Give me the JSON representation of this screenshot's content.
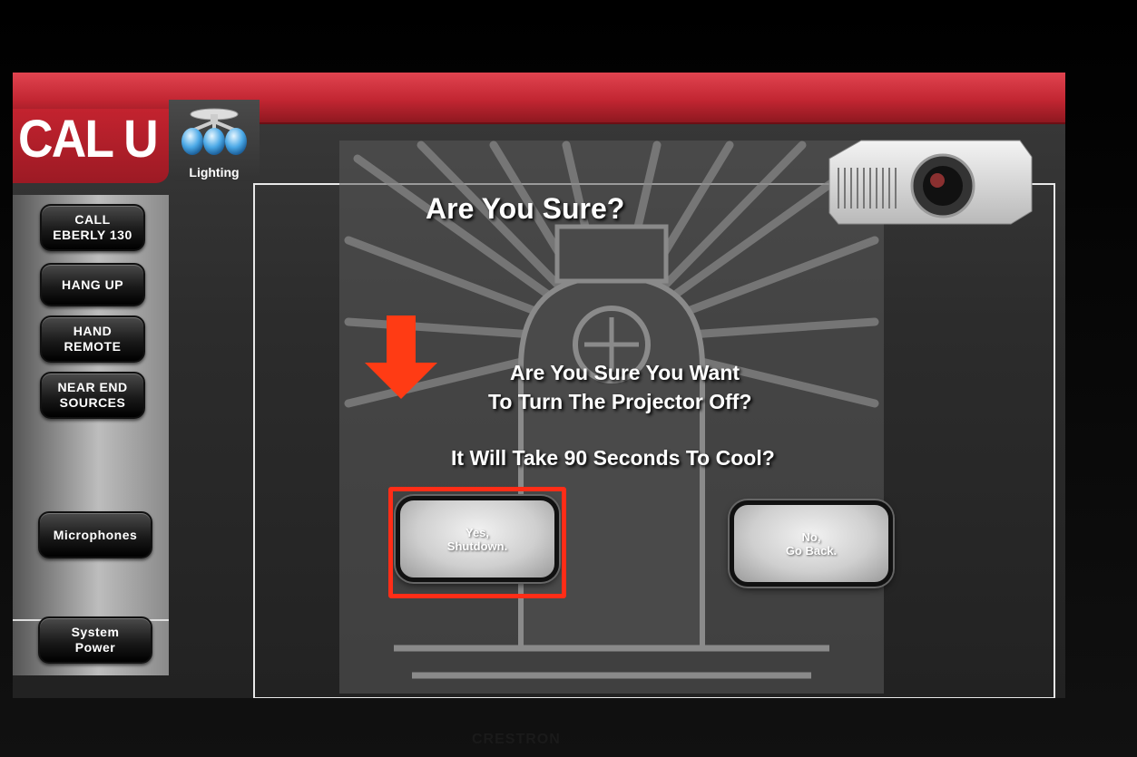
{
  "header": {
    "logo_text": "CAL U",
    "lighting_label": "Lighting"
  },
  "sidebar": {
    "items": [
      {
        "label_line1": "CALL",
        "label_line2": "EBERLY 130"
      },
      {
        "label_line1": "HANG UP",
        "label_line2": ""
      },
      {
        "label_line1": "HAND",
        "label_line2": "REMOTE"
      },
      {
        "label_line1": "NEAR END",
        "label_line2": "SOURCES"
      },
      {
        "label_line1": "Microphones",
        "label_line2": ""
      },
      {
        "label_line1": "System",
        "label_line2": "Power"
      }
    ]
  },
  "dialog": {
    "title": "Are You Sure?",
    "message_line1": "Are You Sure You Want",
    "message_line2": "To Turn The Projector Off?",
    "message_line3": "It Will Take 90 Seconds To Cool?",
    "yes_line1": "Yes,",
    "yes_line2": "Shutdown.",
    "no_line1": "No,",
    "no_line2": "Go Back."
  },
  "colors": {
    "brand_red": "#c22632",
    "highlight": "#ff2d17"
  },
  "icons": [
    "lighting-icon",
    "projector-icon",
    "down-arrow-icon"
  ],
  "footer": {
    "brand": "CRESTRON"
  }
}
